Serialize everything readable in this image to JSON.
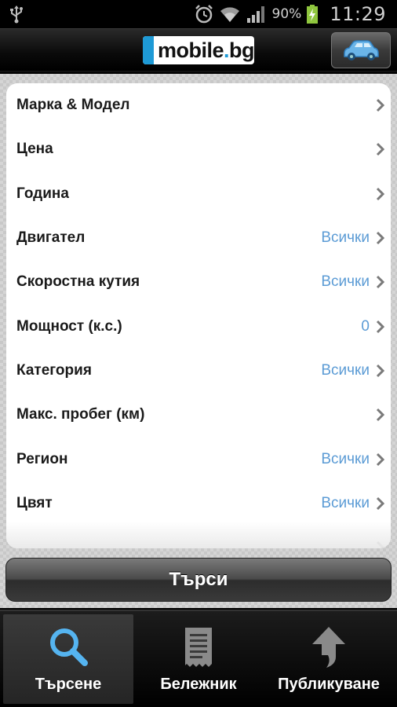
{
  "status_bar": {
    "battery_percent": "90%",
    "time": "11:29",
    "icons": [
      "usb-icon",
      "alarm-icon",
      "wifi-icon",
      "signal-icon",
      "battery-charging-icon"
    ]
  },
  "header": {
    "logo_text": "mobile",
    "logo_dot": ".",
    "logo_suffix": "bg",
    "car_button_icon": "car-icon"
  },
  "filters": [
    {
      "label": "Марка & Модел",
      "value": ""
    },
    {
      "label": "Цена",
      "value": ""
    },
    {
      "label": "Година",
      "value": ""
    },
    {
      "label": "Двигател",
      "value": "Всички"
    },
    {
      "label": "Скоростна кутия",
      "value": "Всички"
    },
    {
      "label": "Мощност (к.с.)",
      "value": "0"
    },
    {
      "label": "Категория",
      "value": "Всички"
    },
    {
      "label": "Макс. пробег (км)",
      "value": ""
    },
    {
      "label": "Регион",
      "value": "Всички"
    },
    {
      "label": "Цвят",
      "value": "Всички"
    }
  ],
  "search_button": "Търси",
  "tabs": [
    {
      "label": "Търсене",
      "icon": "search-icon",
      "active": true
    },
    {
      "label": "Бележник",
      "icon": "notepad-icon",
      "active": false
    },
    {
      "label": "Публикуване",
      "icon": "upload-icon",
      "active": false
    }
  ],
  "colors": {
    "accent_blue": "#5b9bd5",
    "logo_blue": "#1e9ad6"
  }
}
